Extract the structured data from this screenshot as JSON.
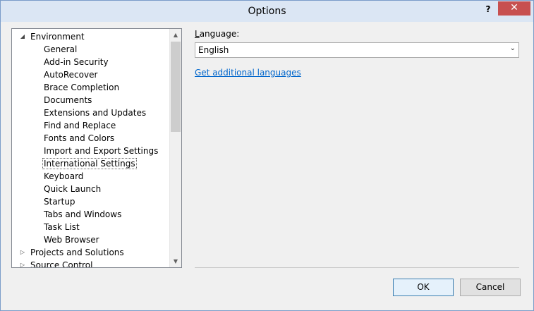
{
  "window": {
    "title": "Options",
    "help_label": "?",
    "close_label": "✕"
  },
  "tree": {
    "items": [
      {
        "label": "Environment",
        "level": 0,
        "expander": "◢",
        "expanded": true
      },
      {
        "label": "General",
        "level": 1
      },
      {
        "label": "Add-in Security",
        "level": 1
      },
      {
        "label": "AutoRecover",
        "level": 1
      },
      {
        "label": "Brace Completion",
        "level": 1
      },
      {
        "label": "Documents",
        "level": 1
      },
      {
        "label": "Extensions and Updates",
        "level": 1
      },
      {
        "label": "Find and Replace",
        "level": 1
      },
      {
        "label": "Fonts and Colors",
        "level": 1
      },
      {
        "label": "Import and Export Settings",
        "level": 1
      },
      {
        "label": "International Settings",
        "level": 1,
        "selected": true
      },
      {
        "label": "Keyboard",
        "level": 1
      },
      {
        "label": "Quick Launch",
        "level": 1
      },
      {
        "label": "Startup",
        "level": 1
      },
      {
        "label": "Tabs and Windows",
        "level": 1
      },
      {
        "label": "Task List",
        "level": 1
      },
      {
        "label": "Web Browser",
        "level": 1
      },
      {
        "label": "Projects and Solutions",
        "level": 0,
        "expander": "▷"
      },
      {
        "label": "Source Control",
        "level": 0,
        "expander": "▷"
      }
    ],
    "scroll_up": "▲",
    "scroll_down": "▼"
  },
  "settings": {
    "language_label_accel": "L",
    "language_label_rest": "anguage:",
    "language_value": "English",
    "dropdown_chevron": "⌄",
    "link_text": "Get additional languages"
  },
  "buttons": {
    "ok": "OK",
    "cancel": "Cancel"
  }
}
